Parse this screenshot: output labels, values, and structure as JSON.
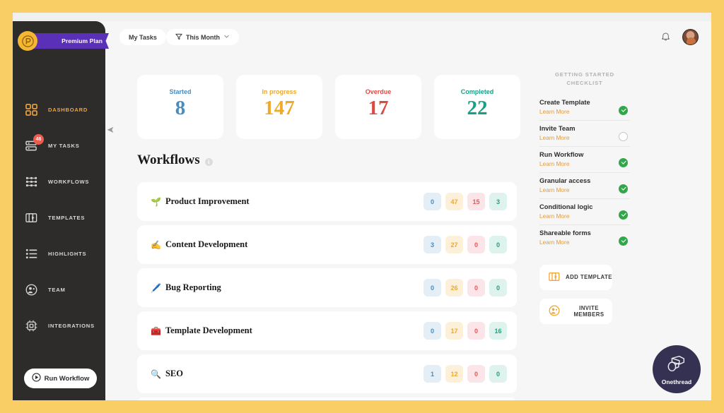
{
  "brand": {
    "plan_label": "Premium Plan",
    "logo_letter": "P"
  },
  "sidebar": {
    "items": [
      {
        "label": "DASHBOARD",
        "icon": "grid-icon",
        "active": true
      },
      {
        "label": "MY TASKS",
        "icon": "tasks-icon",
        "badge": "46"
      },
      {
        "label": "WORKFLOWS",
        "icon": "workflows-icon"
      },
      {
        "label": "TEMPLATES",
        "icon": "templates-icon"
      },
      {
        "label": "HIGHLIGHTS",
        "icon": "highlights-icon"
      },
      {
        "label": "TEAM",
        "icon": "team-icon"
      },
      {
        "label": "INTEGRATIONS",
        "icon": "integrations-icon"
      }
    ],
    "run_workflow_label": "Run Workflow"
  },
  "topbar": {
    "my_tasks_label": "My Tasks",
    "filter_label": "This Month",
    "filter_icon": "funnel-icon",
    "chevron_icon": "chevron-down-icon",
    "bell_icon": "bell-icon"
  },
  "stats": [
    {
      "label": "Started",
      "value": "8",
      "color": "#4A8CBE"
    },
    {
      "label": "In progress",
      "value": "147",
      "color": "#F0A92B"
    },
    {
      "label": "Overdue",
      "value": "17",
      "color": "#DC4B42"
    },
    {
      "label": "Completed",
      "value": "22",
      "color": "#17A085"
    }
  ],
  "workflows": {
    "title": "Workflows",
    "info_icon": "info-icon",
    "rows": [
      {
        "emoji": "🌱",
        "name": "Product Improvement",
        "counts": [
          "0",
          "47",
          "15",
          "3"
        ]
      },
      {
        "emoji": "✍️",
        "name": "Content Development",
        "counts": [
          "3",
          "27",
          "0",
          "0"
        ]
      },
      {
        "emoji": "🖊️",
        "name": "Bug Reporting",
        "counts": [
          "0",
          "26",
          "0",
          "0"
        ]
      },
      {
        "emoji": "🧰",
        "name": "Template Development",
        "counts": [
          "0",
          "17",
          "0",
          "16"
        ]
      },
      {
        "emoji": "🔍",
        "name": "SEO",
        "counts": [
          "1",
          "12",
          "0",
          "0"
        ]
      }
    ]
  },
  "checklist": {
    "title_line1": "GETTING STARTED",
    "title_line2": "CHECKLIST",
    "learn_more_label": "Learn More",
    "items": [
      {
        "name": "Create Template",
        "done": true
      },
      {
        "name": "Invite Team",
        "done": false
      },
      {
        "name": "Run Workflow",
        "done": true
      },
      {
        "name": "Granular access",
        "done": true
      },
      {
        "name": "Conditional logic",
        "done": true
      },
      {
        "name": "Shareable forms",
        "done": true
      }
    ],
    "add_template_label": "ADD TEMPLATE",
    "add_template_icon": "templates-icon",
    "invite_members_label": "INVITE MEMBERS",
    "invite_members_icon": "team-icon"
  },
  "footer_badge": {
    "label": "Onethread",
    "icon": "onethread-logo-icon"
  }
}
